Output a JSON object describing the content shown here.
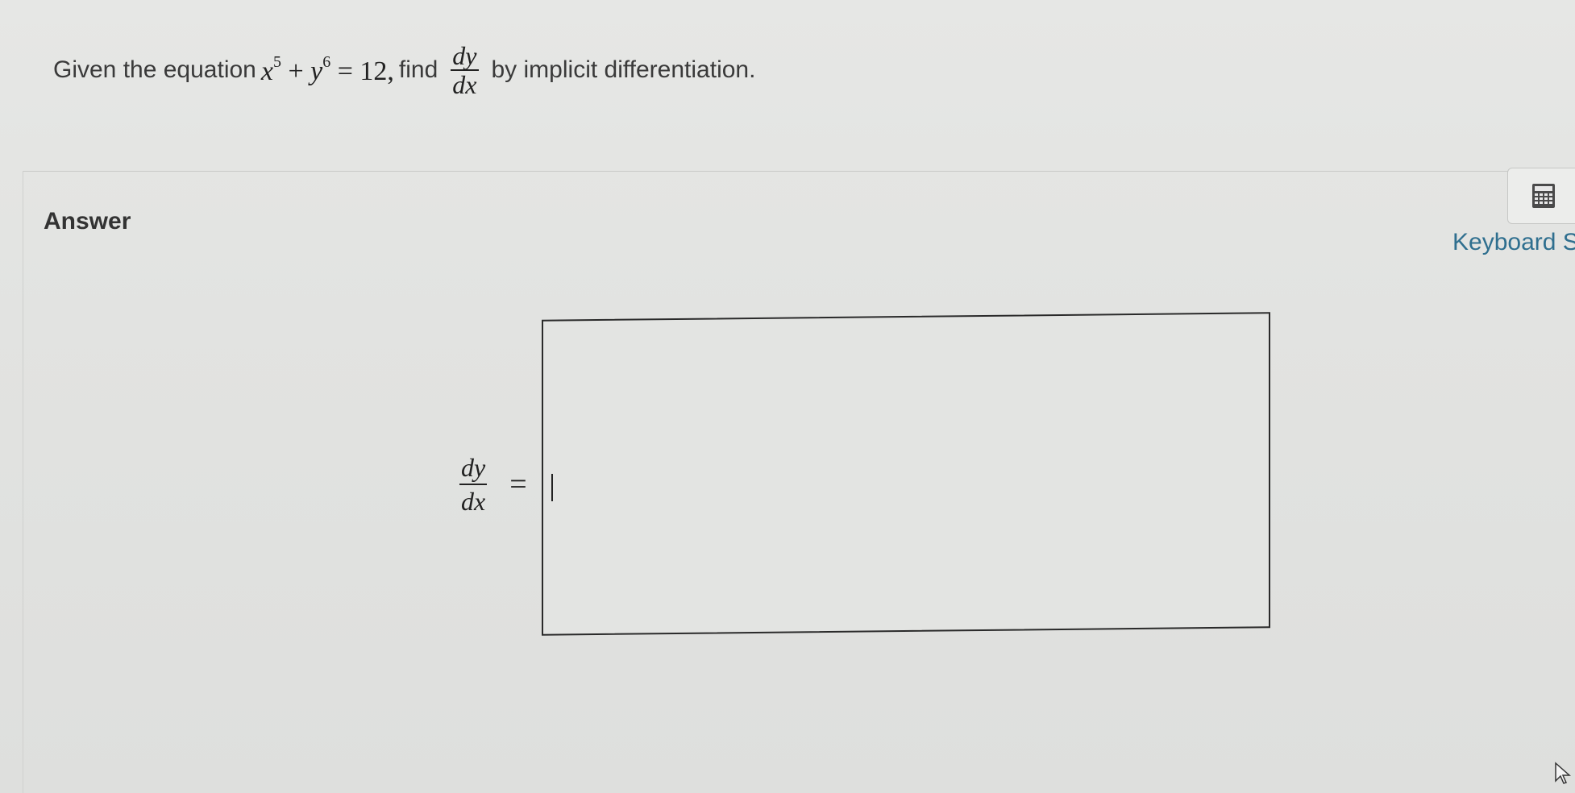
{
  "question": {
    "prefix": "Given the equation",
    "equation_x": "x",
    "equation_x_exp": "5",
    "equation_plus": "+",
    "equation_y": "y",
    "equation_y_exp": "6",
    "equation_rest": "= 12,",
    "find_text": "find",
    "deriv_num": "dy",
    "deriv_den": "dx",
    "suffix": "by implicit differentiation."
  },
  "answer": {
    "label": "Answer",
    "lhs_num": "dy",
    "lhs_den": "dx",
    "equals": "=",
    "input_value": ""
  },
  "toolbar": {
    "calculator_icon": "calculator-icon",
    "keyboard_link": "Keyboard S"
  },
  "colors": {
    "background": "#e4e5e3",
    "link": "#2f6f8f",
    "text": "#333333"
  }
}
